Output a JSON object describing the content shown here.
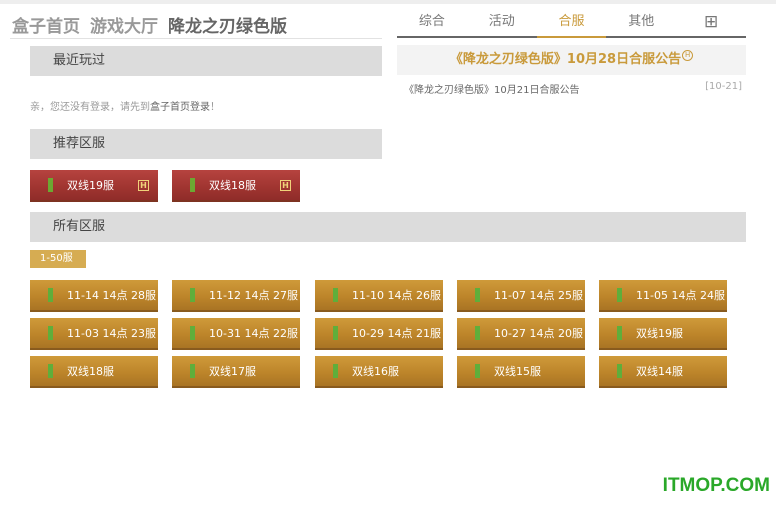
{
  "header": {
    "crumbs": [
      "盒子首页",
      "游戏大厅",
      "降龙之刃绿色版"
    ]
  },
  "tabs": {
    "items": [
      "综合",
      "活动",
      "合服",
      "其他"
    ],
    "active": "合服",
    "more_glyph": "⊞"
  },
  "notice": {
    "title": "《降龙之刃绿色版》10月28日合服公告",
    "hot_glyph": "H",
    "items": [
      {
        "text": "《降龙之刃绿色版》10月21日合服公告",
        "date": "[10-21]"
      }
    ]
  },
  "sections": {
    "recent": "最近玩过",
    "recommend": "推荐区服",
    "all": "所有区服"
  },
  "login_tip": {
    "before": "亲，您还没有登录，请先到",
    "link": "盒子首页登录",
    "after": "！"
  },
  "recommended_servers": [
    "双线19服",
    "双线18服"
  ],
  "hot_badge": "H",
  "range_tag": "1-50服",
  "all_servers": [
    "11-14 14点 28服",
    "11-12 14点 27服",
    "11-10 14点 26服",
    "11-07 14点 25服",
    "11-05 14点 24服",
    "11-03 14点 23服",
    "10-31 14点 22服",
    "10-29 14点 21服",
    "10-27 14点 20服",
    "双线19服",
    "双线18服",
    "双线17服",
    "双线16服",
    "双线15服",
    "双线14服"
  ],
  "watermark": "ITMOP.COM",
  "colors": {
    "accent_gold": "#c99a3b",
    "server_gold": "#bd852a",
    "server_red": "#9f3430",
    "signal_green": "#5fae3b",
    "watermark_green": "#2aa829"
  },
  "icons": {
    "signal": "signal-bar-icon",
    "hot": "hot-badge-icon",
    "more": "grid-plus-icon"
  }
}
